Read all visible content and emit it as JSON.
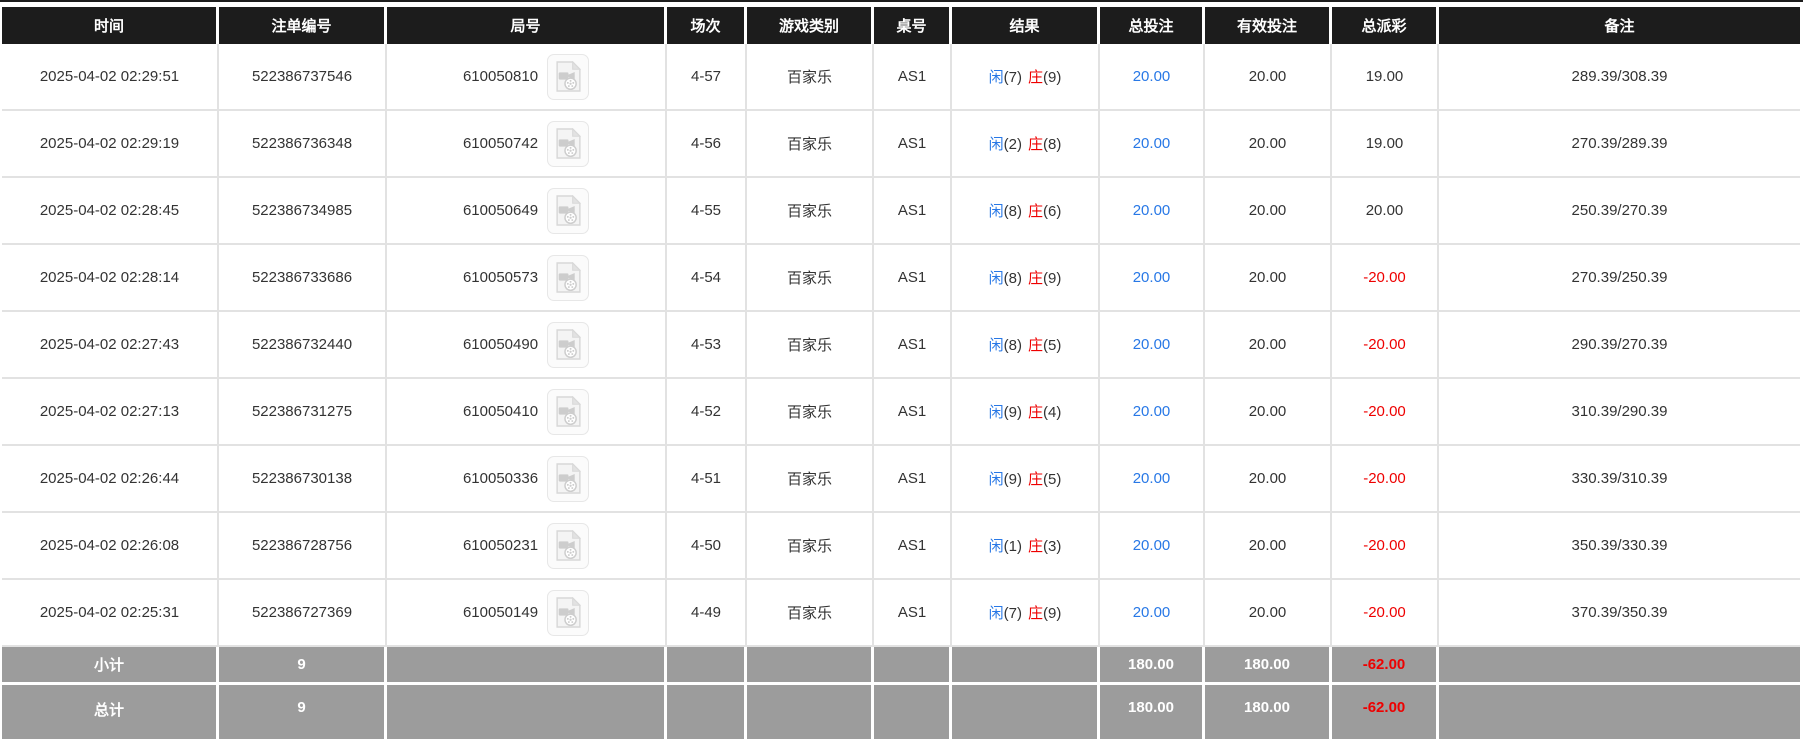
{
  "header": {
    "columns": [
      "时间",
      "注单编号",
      "局号",
      "场次",
      "游戏类别",
      "桌号",
      "结果",
      "总投注",
      "有效投注",
      "总派彩",
      "备注"
    ]
  },
  "result_labels": {
    "player": "闲",
    "banker": "庄"
  },
  "rows": [
    {
      "time": "2025-04-02 02:29:51",
      "bet_id": "522386737546",
      "round_id": "610050810",
      "session": "4-57",
      "game_type": "百家乐",
      "table_no": "AS1",
      "player_score": "(7)",
      "banker_score": "(9)",
      "total_bet": "20.00",
      "valid_bet": "20.00",
      "payout": "19.00",
      "remark": "289.39/308.39"
    },
    {
      "time": "2025-04-02 02:29:19",
      "bet_id": "522386736348",
      "round_id": "610050742",
      "session": "4-56",
      "game_type": "百家乐",
      "table_no": "AS1",
      "player_score": "(2)",
      "banker_score": "(8)",
      "total_bet": "20.00",
      "valid_bet": "20.00",
      "payout": "19.00",
      "remark": "270.39/289.39"
    },
    {
      "time": "2025-04-02 02:28:45",
      "bet_id": "522386734985",
      "round_id": "610050649",
      "session": "4-55",
      "game_type": "百家乐",
      "table_no": "AS1",
      "player_score": "(8)",
      "banker_score": "(6)",
      "total_bet": "20.00",
      "valid_bet": "20.00",
      "payout": "20.00",
      "remark": "250.39/270.39"
    },
    {
      "time": "2025-04-02 02:28:14",
      "bet_id": "522386733686",
      "round_id": "610050573",
      "session": "4-54",
      "game_type": "百家乐",
      "table_no": "AS1",
      "player_score": "(8)",
      "banker_score": "(9)",
      "total_bet": "20.00",
      "valid_bet": "20.00",
      "payout": "-20.00",
      "remark": "270.39/250.39"
    },
    {
      "time": "2025-04-02 02:27:43",
      "bet_id": "522386732440",
      "round_id": "610050490",
      "session": "4-53",
      "game_type": "百家乐",
      "table_no": "AS1",
      "player_score": "(8)",
      "banker_score": "(5)",
      "total_bet": "20.00",
      "valid_bet": "20.00",
      "payout": "-20.00",
      "remark": "290.39/270.39"
    },
    {
      "time": "2025-04-02 02:27:13",
      "bet_id": "522386731275",
      "round_id": "610050410",
      "session": "4-52",
      "game_type": "百家乐",
      "table_no": "AS1",
      "player_score": "(9)",
      "banker_score": "(4)",
      "total_bet": "20.00",
      "valid_bet": "20.00",
      "payout": "-20.00",
      "remark": "310.39/290.39"
    },
    {
      "time": "2025-04-02 02:26:44",
      "bet_id": "522386730138",
      "round_id": "610050336",
      "session": "4-51",
      "game_type": "百家乐",
      "table_no": "AS1",
      "player_score": "(9)",
      "banker_score": "(5)",
      "total_bet": "20.00",
      "valid_bet": "20.00",
      "payout": "-20.00",
      "remark": "330.39/310.39"
    },
    {
      "time": "2025-04-02 02:26:08",
      "bet_id": "522386728756",
      "round_id": "610050231",
      "session": "4-50",
      "game_type": "百家乐",
      "table_no": "AS1",
      "player_score": "(1)",
      "banker_score": "(3)",
      "total_bet": "20.00",
      "valid_bet": "20.00",
      "payout": "-20.00",
      "remark": "350.39/330.39"
    },
    {
      "time": "2025-04-02 02:25:31",
      "bet_id": "522386727369",
      "round_id": "610050149",
      "session": "4-49",
      "game_type": "百家乐",
      "table_no": "AS1",
      "player_score": "(7)",
      "banker_score": "(9)",
      "total_bet": "20.00",
      "valid_bet": "20.00",
      "payout": "-20.00",
      "remark": "370.39/350.39"
    }
  ],
  "footer": [
    {
      "label": "小计",
      "count": "9",
      "total_bet": "180.00",
      "valid_bet": "180.00",
      "payout": "-62.00"
    },
    {
      "label": "总计",
      "count": "9",
      "total_bet": "180.00",
      "valid_bet": "180.00",
      "payout": "-62.00"
    }
  ],
  "colors": {
    "header_bg": "#1c1c1c",
    "footer_bg": "#9c9c9c",
    "link_blue": "#2878e6",
    "negative_red": "#ee0000",
    "body_text": "#333333",
    "cell_border": "#e2e2e2"
  },
  "icons": {
    "round_video": "video-file-icon"
  }
}
